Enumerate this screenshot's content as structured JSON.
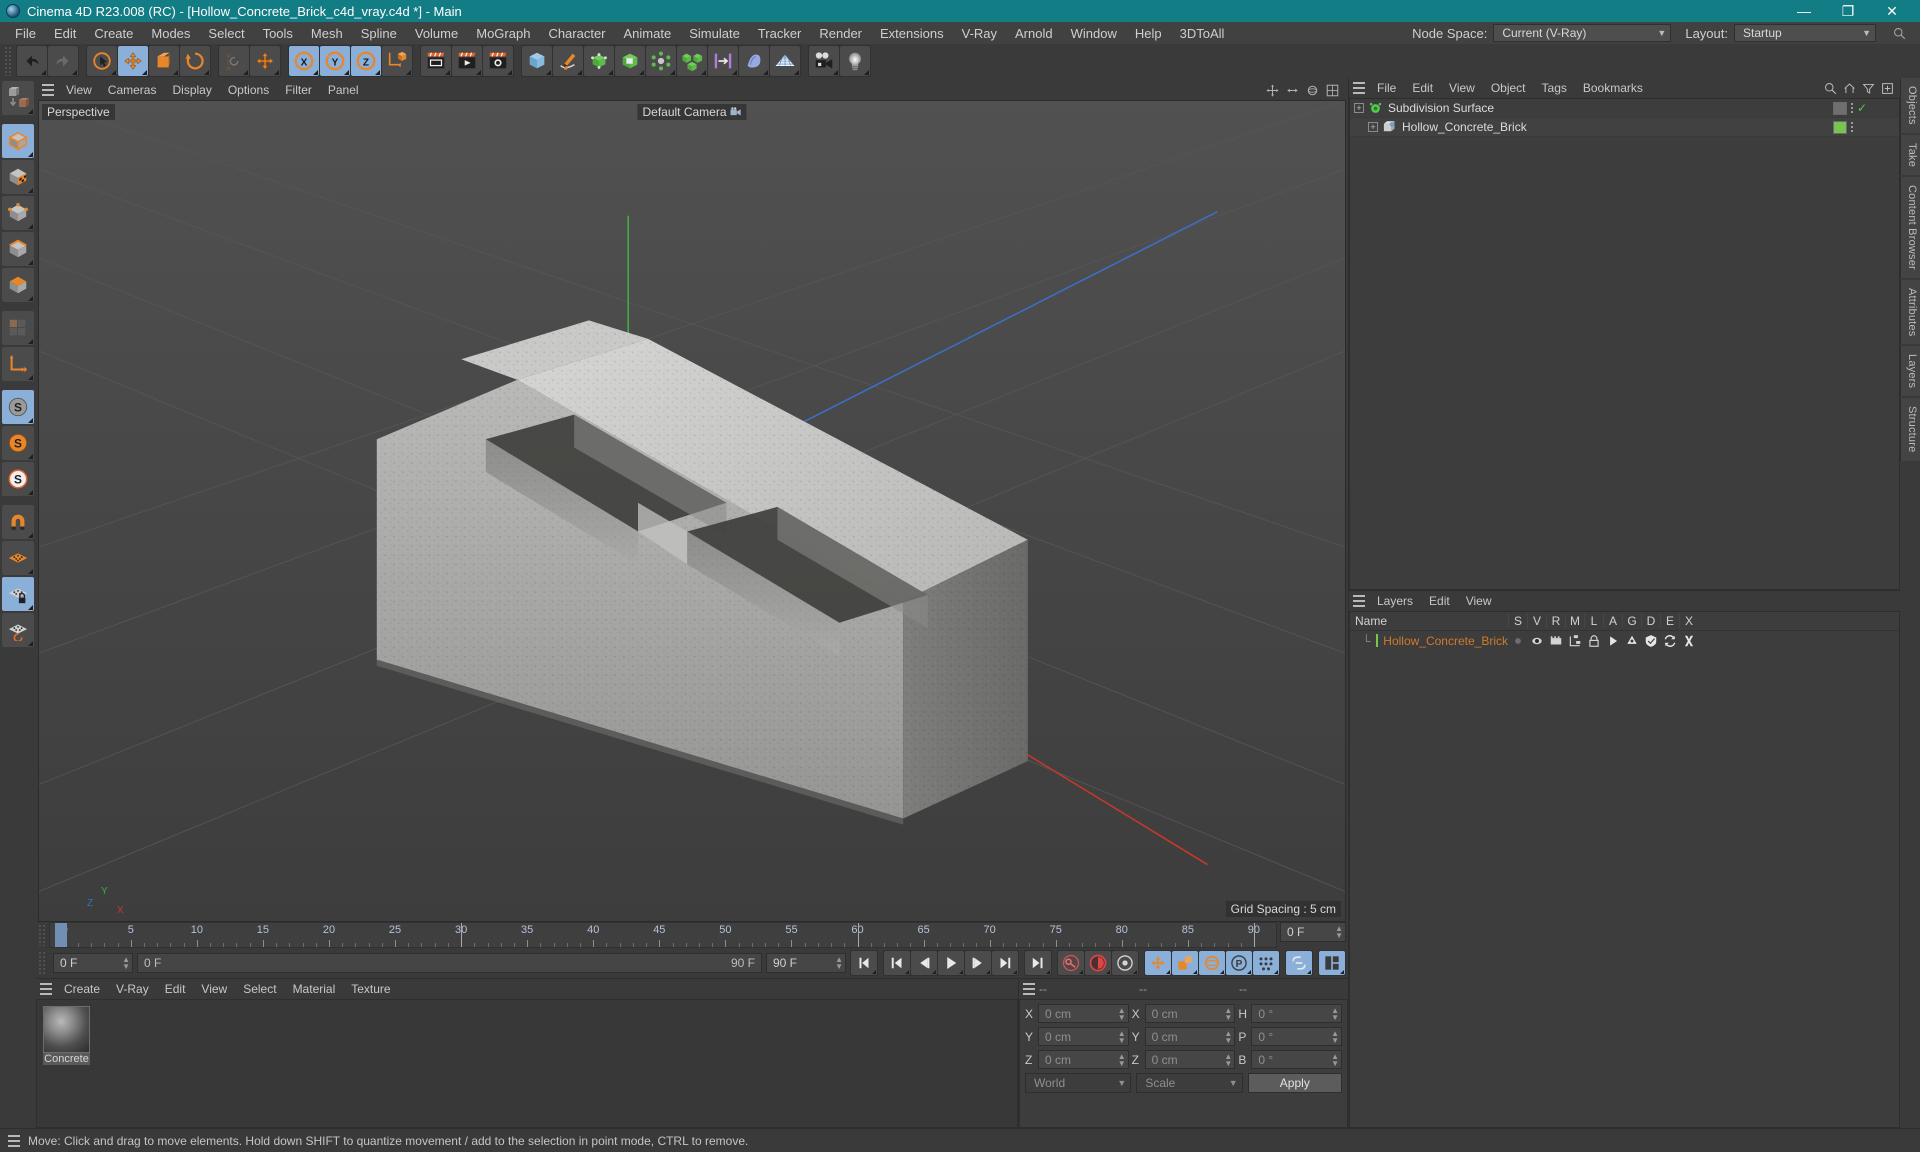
{
  "window": {
    "title": "Cinema 4D R23.008 (RC) - [Hollow_Concrete_Brick_c4d_vray.c4d *] - Main",
    "minimize": "—",
    "maximize": "❐",
    "close": "✕"
  },
  "menubar": {
    "items": [
      "File",
      "Edit",
      "Create",
      "Modes",
      "Select",
      "Tools",
      "Mesh",
      "Spline",
      "Volume",
      "MoGraph",
      "Character",
      "Animate",
      "Simulate",
      "Tracker",
      "Render",
      "Extensions",
      "V-Ray",
      "Arnold",
      "Window",
      "Help",
      "3DToAll"
    ],
    "node_space_label": "Node Space:",
    "node_space_value": "Current (V-Ray)",
    "layout_label": "Layout:",
    "layout_value": "Startup"
  },
  "toolbar": {
    "buttons": [
      {
        "name": "undo-button",
        "icon": "undo",
        "active": false
      },
      {
        "name": "redo-button",
        "icon": "redo",
        "active": false
      },
      {
        "name": "live-selection-button",
        "icon": "cursor-circle",
        "active": false
      },
      {
        "name": "move-tool-button",
        "icon": "move-arrows",
        "active": true
      },
      {
        "name": "scale-tool-button",
        "icon": "scale-box",
        "active": false
      },
      {
        "name": "rotate-tool-button",
        "icon": "rotate-circle",
        "active": false
      },
      {
        "name": "psr-lock-button",
        "icon": "psr",
        "active": false
      },
      {
        "name": "world-local-button",
        "icon": "move-arrows",
        "active": false
      },
      {
        "name": "axis-x-button",
        "icon": "x-axis",
        "active": true
      },
      {
        "name": "axis-y-button",
        "icon": "y-axis",
        "active": true
      },
      {
        "name": "axis-z-button",
        "icon": "z-axis",
        "active": true
      },
      {
        "name": "object-axis-button",
        "icon": "axis-cube",
        "active": false
      },
      {
        "name": "render-view-button",
        "icon": "clapper-frame",
        "active": false
      },
      {
        "name": "render-to-picture-button",
        "icon": "clapper-play",
        "active": false
      },
      {
        "name": "render-settings-button",
        "icon": "clapper-gear",
        "active": false
      },
      {
        "name": "cube-primitive-button",
        "icon": "cube-blue",
        "active": false
      },
      {
        "name": "spline-pen-button",
        "icon": "pen-spline",
        "active": false
      },
      {
        "name": "generator-button",
        "icon": "nurbs-green",
        "active": false
      },
      {
        "name": "bend-deformer-button",
        "icon": "deformer-green",
        "active": false
      },
      {
        "name": "mograph-button",
        "icon": "atom-green",
        "active": false
      },
      {
        "name": "cloner-button",
        "icon": "cloner-green",
        "active": false
      },
      {
        "name": "dynamics-button",
        "icon": "constraint-purple",
        "active": false
      },
      {
        "name": "field-button",
        "icon": "field-blue",
        "active": false
      },
      {
        "name": "floor-environment-button",
        "icon": "floor-grid",
        "active": false
      },
      {
        "name": "camera-button",
        "icon": "camera",
        "active": false
      },
      {
        "name": "light-button",
        "icon": "light-bulb",
        "active": false
      }
    ]
  },
  "left_toolbar": {
    "buttons": [
      {
        "name": "make-editable-button",
        "icon": "make-editable",
        "active": false
      },
      {
        "name": "model-mode-button",
        "icon": "model-cube",
        "active": true
      },
      {
        "name": "texture-mode-button",
        "icon": "texture-cube",
        "active": false
      },
      {
        "name": "points-mode-button",
        "icon": "points-cube",
        "active": false
      },
      {
        "name": "edges-mode-button",
        "icon": "edges-cube",
        "active": false
      },
      {
        "name": "polygons-mode-button",
        "icon": "polygons-cube",
        "active": false
      },
      {
        "name": "uv-mode-button",
        "icon": "uv-tiles",
        "active": false
      },
      {
        "name": "axis-mode-button",
        "icon": "axis-arrow",
        "active": false
      },
      {
        "name": "enable-axis-button",
        "icon": "s-gray",
        "active": true
      },
      {
        "name": "viewport-solo-button",
        "icon": "s-orange",
        "active": false
      },
      {
        "name": "workplane-button",
        "icon": "s-white",
        "active": false
      },
      {
        "name": "snap-magnet-button",
        "icon": "magnet",
        "active": false
      },
      {
        "name": "grid-snap-button",
        "icon": "grid-orange",
        "active": false
      },
      {
        "name": "lock-workplane-button",
        "icon": "grid-lock",
        "active": true
      },
      {
        "name": "workplane-rotate-button",
        "icon": "grid-rotate",
        "active": false
      }
    ]
  },
  "viewport": {
    "menu": [
      "View",
      "Cameras",
      "Display",
      "Options",
      "Filter",
      "Panel"
    ],
    "projection_label": "Perspective",
    "camera_label": "Default Camera",
    "grid_spacing_label": "Grid Spacing : 5 cm",
    "axis_gizmo": {
      "y": "Y",
      "z": "Z",
      "x": "X"
    },
    "icons": [
      "pan-icon",
      "zoom-icon",
      "rotate-icon",
      "maximize-icon"
    ]
  },
  "timeline": {
    "start_frame_field": "0 F",
    "current_frame_field": "0 F",
    "end_frame_field": "90 F",
    "preview_end_field": "90 F",
    "right_frame_field": "0 F",
    "timebar_left": "0 F",
    "timebar_right": "90 F",
    "ruler_min": 0,
    "ruler_max": 90,
    "ruler_labels": [
      0,
      5,
      10,
      15,
      20,
      25,
      30,
      35,
      40,
      45,
      50,
      55,
      60,
      65,
      70,
      75,
      80,
      85,
      90
    ],
    "playhead_frame": 0,
    "transport_buttons": [
      {
        "name": "go-to-start-button",
        "icon": "skip-start",
        "active": false
      },
      {
        "name": "previous-key-button",
        "icon": "prev-key",
        "active": false
      },
      {
        "name": "previous-frame-button",
        "icon": "prev-frame",
        "active": false
      },
      {
        "name": "play-button",
        "icon": "play",
        "active": false
      },
      {
        "name": "next-frame-button",
        "icon": "next-frame",
        "active": false
      },
      {
        "name": "next-key-button",
        "icon": "next-key",
        "active": false
      },
      {
        "name": "go-to-end-button",
        "icon": "skip-end",
        "active": false
      },
      {
        "name": "record-key-button",
        "icon": "key-red",
        "active": false
      },
      {
        "name": "autokey-button",
        "icon": "autokey-red",
        "active": false
      },
      {
        "name": "keyframe-selection-button",
        "icon": "key-select",
        "active": false
      },
      {
        "name": "position-key-button",
        "icon": "pos-key",
        "active": true
      },
      {
        "name": "scale-key-button",
        "icon": "scale-key",
        "active": true
      },
      {
        "name": "rotation-key-button",
        "icon": "rot-key",
        "active": true
      },
      {
        "name": "parameter-key-button",
        "icon": "param-key",
        "active": true
      },
      {
        "name": "point-level-animation-button",
        "icon": "pla-key",
        "active": true
      },
      {
        "name": "link-button",
        "icon": "link",
        "active": true
      },
      {
        "name": "timeline-settings-button",
        "icon": "tl-settings",
        "active": true
      }
    ]
  },
  "material_manager": {
    "menu": [
      "Create",
      "V-Ray",
      "Edit",
      "View",
      "Select",
      "Material",
      "Texture"
    ],
    "materials": [
      {
        "name": "Concrete"
      }
    ]
  },
  "coordinates": {
    "header_dashes": [
      "--",
      "--",
      "--"
    ],
    "rows": [
      {
        "pos_axis": "X",
        "pos_value": "0 cm",
        "size_axis": "X",
        "size_value": "0 cm",
        "rot_axis": "H",
        "rot_value": "0 °"
      },
      {
        "pos_axis": "Y",
        "pos_value": "0 cm",
        "size_axis": "Y",
        "size_value": "0 cm",
        "rot_axis": "P",
        "rot_value": "0 °"
      },
      {
        "pos_axis": "Z",
        "pos_value": "0 cm",
        "size_axis": "Z",
        "size_value": "0 cm",
        "rot_axis": "B",
        "rot_value": "0 °"
      }
    ],
    "coord_system": "World",
    "mode": "Scale",
    "apply_label": "Apply"
  },
  "object_manager": {
    "menu": [
      "File",
      "Edit",
      "View",
      "Object",
      "Tags",
      "Bookmarks"
    ],
    "icons": [
      "search-icon",
      "home-icon",
      "filter-icon",
      "add-icon"
    ],
    "rows": [
      {
        "name": "Subdivision Surface",
        "depth": 0,
        "icon_color": "#57c94b",
        "icon": "subdivision-surface-icon",
        "tag_color": "#6f6f6f",
        "checked": true
      },
      {
        "name": "Hollow_Concrete_Brick",
        "depth": 1,
        "icon_color": "#8fb9e8",
        "icon": "polygon-object-icon",
        "tag_color": "#76c451",
        "checked": false
      }
    ]
  },
  "layer_manager": {
    "menu": [
      "Layers",
      "Edit",
      "View"
    ],
    "columns": [
      "S",
      "V",
      "R",
      "M",
      "L",
      "A",
      "G",
      "D",
      "E",
      "X"
    ],
    "name_column": "Name",
    "rows": [
      {
        "name": "Hollow_Concrete_Brick",
        "color": "#76c451"
      }
    ]
  },
  "right_rail": {
    "tabs": [
      "Objects",
      "Take",
      "Content Browser",
      "Attributes",
      "Layers",
      "Structure"
    ]
  },
  "statusbar": {
    "message": "Move: Click and drag to move elements. Hold down SHIFT to quantize movement / add to the selection in point mode, CTRL to remove."
  },
  "colors": {
    "title_bar": "#127d84",
    "accent_blue": "#8aafd8",
    "axis_x": "#c0392b",
    "axis_y": "#3fae3f",
    "axis_z": "#3b6fc4",
    "layer_green": "#76c451",
    "layer_text": "#d07b2a"
  }
}
